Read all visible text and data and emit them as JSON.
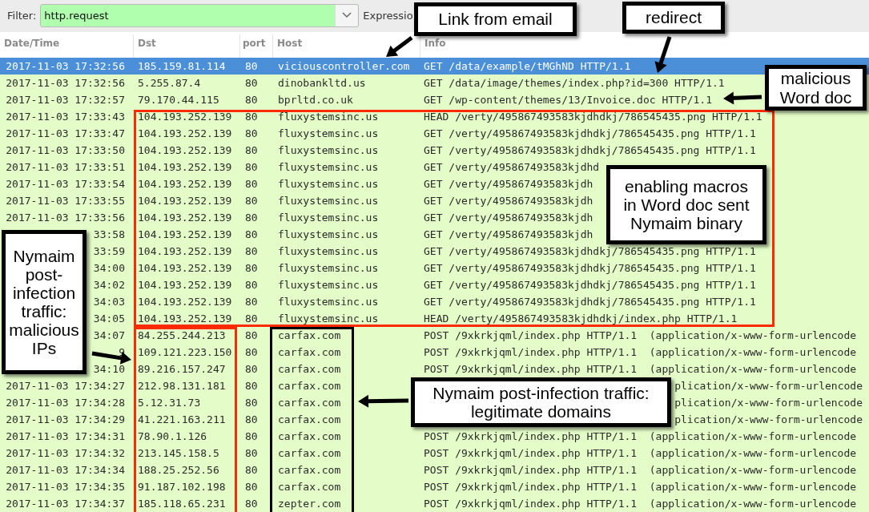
{
  "filter_bar": {
    "label": "Filter:",
    "value": "http.request",
    "expression_button": "Expressio"
  },
  "columns": [
    "Date/Time",
    "Dst",
    "port",
    "Host",
    "Info"
  ],
  "rows": [
    {
      "time": "2017-11-03 17:32:56",
      "dst": "185.159.81.114",
      "port": "80",
      "host": "viciouscontroller.com",
      "info": "GET /data/example/tMGhND HTTP/1.1",
      "selected": true
    },
    {
      "time": "2017-11-03 17:32:56",
      "dst": "5.255.87.4",
      "port": "80",
      "host": "dinobankltd.us",
      "info": "GET /data/image/themes/index.php?id=300 HTTP/1.1",
      "selected": false
    },
    {
      "time": "2017-11-03 17:32:57",
      "dst": "79.170.44.115",
      "port": "80",
      "host": "bprltd.co.uk",
      "info": "GET /wp-content/themes/13/Invoice.doc HTTP/1.1",
      "selected": false
    },
    {
      "time": "2017-11-03 17:33:43",
      "dst": "104.193.252.139",
      "port": "80",
      "host": "fluxystemsinc.us",
      "info": "HEAD /verty/495867493583kjdhdkj/786545435.png HTTP/1.1",
      "selected": false
    },
    {
      "time": "2017-11-03 17:33:47",
      "dst": "104.193.252.139",
      "port": "80",
      "host": "fluxystemsinc.us",
      "info": "GET /verty/495867493583kjdhdkj/786545435.png HTTP/1.1",
      "selected": false
    },
    {
      "time": "2017-11-03 17:33:50",
      "dst": "104.193.252.139",
      "port": "80",
      "host": "fluxystemsinc.us",
      "info": "GET /verty/495867493583kjdhdkj/786545435.png HTTP/1.1",
      "selected": false
    },
    {
      "time": "2017-11-03 17:33:51",
      "dst": "104.193.252.139",
      "port": "80",
      "host": "fluxystemsinc.us",
      "info": "GET /verty/495867493583kjdhd",
      "selected": false
    },
    {
      "time": "2017-11-03 17:33:54",
      "dst": "104.193.252.139",
      "port": "80",
      "host": "fluxystemsinc.us",
      "info": "GET /verty/495867493583kjdh",
      "selected": false
    },
    {
      "time": "2017-11-03 17:33:55",
      "dst": "104.193.252.139",
      "port": "80",
      "host": "fluxystemsinc.us",
      "info": "GET /verty/495867493583kjdh",
      "selected": false
    },
    {
      "time": "2017-11-03 17:33:56",
      "dst": "104.193.252.139",
      "port": "80",
      "host": "fluxystemsinc.us",
      "info": "GET /verty/495867493583kjdh",
      "selected": false
    },
    {
      "time": "33:58",
      "dst": "104.193.252.139",
      "port": "80",
      "host": "fluxystemsinc.us",
      "info": "GET /verty/495867493583kjdh",
      "selected": false
    },
    {
      "time": "33:59",
      "dst": "104.193.252.139",
      "port": "80",
      "host": "fluxystemsinc.us",
      "info": "GET /verty/495867493583kjdhdkj/786545435.png HTTP/1.1",
      "selected": false
    },
    {
      "time": "34:00",
      "dst": "104.193.252.139",
      "port": "80",
      "host": "fluxystemsinc.us",
      "info": "GET /verty/495867493583kjdhdkj/786545435.png HTTP/1.1",
      "selected": false
    },
    {
      "time": "34:02",
      "dst": "104.193.252.139",
      "port": "80",
      "host": "fluxystemsinc.us",
      "info": "GET /verty/495867493583kjdhdkj/786545435.png HTTP/1.1",
      "selected": false
    },
    {
      "time": "34:03",
      "dst": "104.193.252.139",
      "port": "80",
      "host": "fluxystemsinc.us",
      "info": "GET /verty/495867493583kjdhdkj/786545435.png HTTP/1.1",
      "selected": false
    },
    {
      "time": "34:05",
      "dst": "104.193.252.139",
      "port": "80",
      "host": "fluxystemsinc.us",
      "info": "HEAD /verty/495867493583kjdhdkj/index.php HTTP/1.1",
      "selected": false
    },
    {
      "time": "34:07",
      "dst": "84.255.244.213",
      "port": "80",
      "host": "carfax.com",
      "info": "POST /9xkrkjqml/index.php HTTP/1.1  (application/x-www-form-urlencode",
      "selected": false
    },
    {
      "time": "9",
      "dst": "109.121.223.150",
      "port": "80",
      "host": "carfax.com",
      "info": "POST /9xkrkjqml/index.php HTTP/1.1  (application/x-www-form-urlencode",
      "selected": false
    },
    {
      "time": "34:10",
      "dst": "89.216.157.247",
      "port": "80",
      "host": "carfax.com",
      "info": "POST /9xkrkjqml/index.php HTTP/1.1  (application/x-www-form-urlencode",
      "selected": false
    },
    {
      "time": "2017-11-03 17:34:27",
      "dst": "212.98.131.181",
      "port": "80",
      "host": "carfax.com",
      "info_tail": "plication/x-www-form-urlencode",
      "selected": false
    },
    {
      "time": "2017-11-03 17:34:28",
      "dst": "5.12.31.73",
      "port": "80",
      "host": "carfax.com",
      "info_tail": "plication/x-www-form-urlencode",
      "selected": false
    },
    {
      "time": "2017-11-03 17:34:29",
      "dst": "41.221.163.211",
      "port": "80",
      "host": "carfax.com",
      "info_tail": "plication/x-www-form-urlencode",
      "selected": false
    },
    {
      "time": "2017-11-03 17:34:31",
      "dst": "78.90.1.126",
      "port": "80",
      "host": "carfax.com",
      "info": "POST /9xkrkjqml/index.php HTTP/1.1  (application/x-www-form-urlencode",
      "selected": false
    },
    {
      "time": "2017-11-03 17:34:32",
      "dst": "213.145.158.5",
      "port": "80",
      "host": "carfax.com",
      "info": "POST /9xkrkjqml/index.php HTTP/1.1  (application/x-www-form-urlencode",
      "selected": false
    },
    {
      "time": "2017-11-03 17:34:34",
      "dst": "188.25.252.56",
      "port": "80",
      "host": "carfax.com",
      "info": "POST /9xkrkjqml/index.php HTTP/1.1  (application/x-www-form-urlencode",
      "selected": false
    },
    {
      "time": "2017-11-03 17:34:35",
      "dst": "91.187.102.198",
      "port": "80",
      "host": "carfax.com",
      "info": "POST /9xkrkjqml/index.php HTTP/1.1  (application/x-www-form-urlencode",
      "selected": false
    },
    {
      "time": "2017-11-03 17:34:37",
      "dst": "185.118.65.231",
      "port": "80",
      "host": "zepter.com",
      "info": "POST /9xkrkjqml/index.php HTTP/1.1  (application/x-www-form-urlencode",
      "selected": false
    }
  ],
  "frames": [
    {
      "color": "#ff2a00"
    },
    {
      "color": "#ff2a00"
    },
    {
      "color": "#000000"
    }
  ],
  "callouts": [
    {
      "lines": [
        "Link from email"
      ]
    },
    {
      "lines": [
        "redirect"
      ]
    },
    {
      "lines": [
        "malicious",
        "Word doc"
      ]
    },
    {
      "lines": [
        "enabling macros",
        "in Word doc sent",
        "Nymaim binary"
      ]
    },
    {
      "lines": [
        "Nymaim",
        "post-",
        "infection",
        "traffic:",
        "malicious",
        "IPs"
      ]
    },
    {
      "lines": [
        "Nymaim post-infection traffic:",
        "legitimate domains"
      ]
    }
  ]
}
